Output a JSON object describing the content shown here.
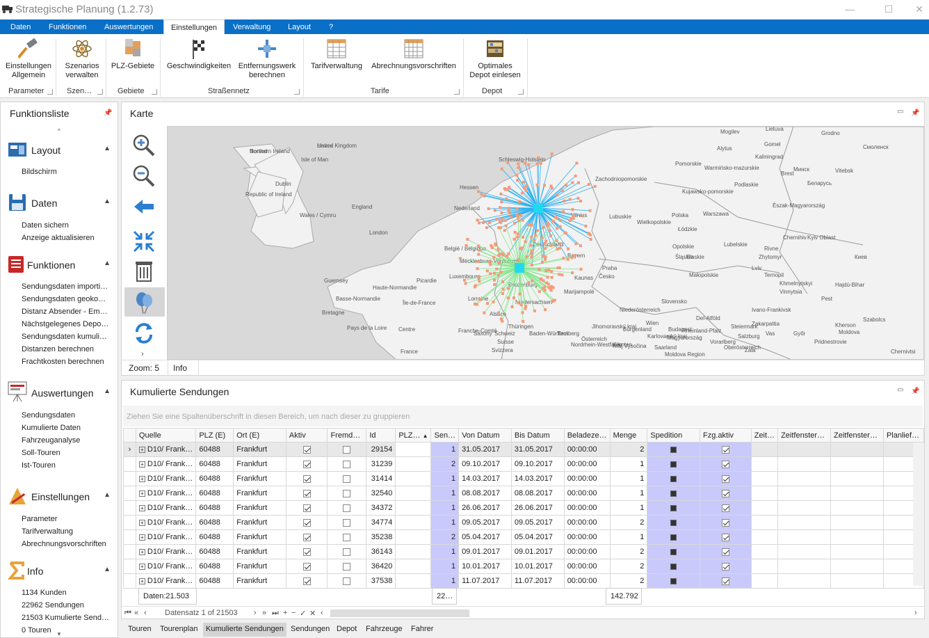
{
  "window": {
    "title": "Strategische Planung (1.2.73)",
    "minimize": "—",
    "maximize": "☐",
    "close": "✕"
  },
  "menubar": {
    "items": [
      "Daten",
      "Funktionen",
      "Auswertungen",
      "Einstellungen",
      "Verwaltung",
      "Layout",
      "?"
    ],
    "active": "Einstellungen"
  },
  "ribbon": {
    "buttons": [
      {
        "label1": "Einstellungen",
        "label2": "Allgemein"
      },
      {
        "label1": "Szenarios",
        "label2": "verwalten"
      },
      {
        "label1": "PLZ-Gebiete",
        "label2": ""
      },
      {
        "label1": "Geschwindigkeiten",
        "label2": ""
      },
      {
        "label1": "Entfernungswerk",
        "label2": "berechnen"
      },
      {
        "label1": "Tarifverwaltung",
        "label2": ""
      },
      {
        "label1": "Abrechnungsvorschriften",
        "label2": ""
      },
      {
        "label1": "Optimales",
        "label2": "Depot einlesen"
      }
    ],
    "groups": [
      "Parameter",
      "Szen…",
      "Gebiete",
      "Straßennetz",
      "Tarife",
      "Depot"
    ]
  },
  "funktionsliste": {
    "title": "Funktionsliste",
    "sections": [
      {
        "label": "Layout",
        "items": [
          "Bildschirm"
        ]
      },
      {
        "label": "Daten",
        "items": [
          "Daten sichern",
          "Anzeige aktualisieren"
        ]
      },
      {
        "label": "Funktionen",
        "items": [
          "Sendungsdaten importi…",
          "Sendungsdaten geoko…",
          "Distanz Absender - Em…",
          "Nächstgelegenes Depo…",
          "Sendungsdaten kumuli…",
          "Distanzen berechnen",
          "Frachtkosten berechnen"
        ]
      },
      {
        "label": "Auswertungen",
        "items": [
          "Sendungsdaten",
          "Kumulierte Daten",
          "Fahrzeuganalyse",
          "Soll-Touren",
          "Ist-Touren"
        ]
      },
      {
        "label": "Einstellungen",
        "items": [
          "Parameter",
          "Tarifverwaltung",
          "Abrechnungsvorschriften"
        ]
      },
      {
        "label": "Info",
        "items": [
          "1134 Kunden",
          "22962 Sendungen",
          "21503 Kumulierte Send…",
          "0 Touren"
        ]
      }
    ]
  },
  "map": {
    "title": "Karte",
    "zoom": "Zoom: 5",
    "info": "Info",
    "labels": [
      "Northern Ireland",
      "United Kingdom",
      "Isle of Man",
      "Dublin",
      "Republic of Ireland",
      "England",
      "Wales / Cymru",
      "London",
      "Nederland",
      "België / Belgique",
      "Luxembourg",
      "Deutschland",
      "Guernsey",
      "Haute-Normandie",
      "Basse-Normandie",
      "Picardie",
      "Île-de-France",
      "Lorraine",
      "Alsace",
      "Bretagne",
      "Pays de la Loire",
      "Centre",
      "Franche-Comté",
      "Schweiz",
      "Suisse",
      "Svizzera",
      "France",
      "Polska",
      "Warszawa",
      "Praha",
      "Česko",
      "Slovensko",
      "Österreich",
      "Budapest",
      "Magyarország",
      "Lietuva",
      "Смоленск",
      "Минск",
      "Беларусь",
      "Киев",
      "Moldova",
      "Kärnten",
      "Burgenland",
      "Bayern",
      "Lubuskie",
      "Łódzkie",
      "Opolskie",
      "Śląskie",
      "Małopolskie",
      "Lubelskie",
      "Pomorskie",
      "Podlaskie",
      "Kujawsko-pomorskie",
      "Warmińsko-mazurskie",
      "Wielkopolskie",
      "Zachodniopomorskie",
      "Mecklenburg-Vorpommern",
      "Schleswig-Holstein",
      "Niedersachsen",
      "Niederösterreich",
      "Tirol",
      "Wien",
      "Slaskie",
      "Lviv",
      "Rivne",
      "Zhytomyr",
      "Chernihiv",
      "Kyiv Oblast",
      "Khmelnytskyi",
      "Vinnytsia",
      "Ternopil",
      "Ivano-Frankivsk",
      "Zakarpattia",
      "Chernivtsi",
      "Kherson",
      "Pridnestrovie",
      "Moldova Region",
      "Del-Alföld",
      "Észak-Magyarország",
      "Brest",
      "Grodno",
      "Vitebsk",
      "Mogilev",
      "Gomel",
      "Kaliningrad",
      "Alytus",
      "Vilnius",
      "Kaunas",
      "Marijampolė",
      "Bradenburg",
      "Saxony",
      "Thüringen",
      "Hessen",
      "Rheinland-Pfalz",
      "Saarland",
      "Baden-Württemberg",
      "Nordrhein-Westfalen",
      "Jihomoravský kraj",
      "Kraj Vysočina",
      "Karlovarský kraj",
      "Vorarlberg",
      "Salzburg",
      "Steiermark",
      "Oberösterreich",
      "Zala",
      "Vas",
      "Győr",
      "Pest",
      "Hajdú-Bihar",
      "Szabolcs",
      "Borsod",
      "Heves"
    ]
  },
  "grid": {
    "title": "Kumulierte Sendungen",
    "grouphint": "Ziehen Sie eine Spaltenüberschrift in diesen Bereich, um nach dieser zu gruppieren",
    "columns": [
      "Quelle",
      "PLZ (E)",
      "Ort (E)",
      "Aktiv",
      "Fremd…",
      "Id",
      "PLZ…",
      "Sen…",
      "Von Datum",
      "Bis Datum",
      "Beladeze…",
      "Menge",
      "Spedition",
      "Fzg.aktiv",
      "Zeit…",
      "Zeitfenster…",
      "Zeitfenster…",
      "Planlief…"
    ],
    "rows": [
      {
        "quelle": "D10/ Frank…",
        "plz": "60488",
        "ort": "Frankfurt",
        "aktiv": true,
        "fremd": false,
        "id": "29154",
        "sen": "1",
        "von": "31.05.2017",
        "bis": "31.05.2017",
        "belade": "00:00:00",
        "menge": "2"
      },
      {
        "quelle": "D10/ Frank…",
        "plz": "60488",
        "ort": "Frankfurt",
        "aktiv": true,
        "fremd": false,
        "id": "31239",
        "sen": "2",
        "von": "09.10.2017",
        "bis": "09.10.2017",
        "belade": "00:00:00",
        "menge": "1"
      },
      {
        "quelle": "D10/ Frank…",
        "plz": "60488",
        "ort": "Frankfurt",
        "aktiv": true,
        "fremd": false,
        "id": "31414",
        "sen": "1",
        "von": "14.03.2017",
        "bis": "14.03.2017",
        "belade": "00:00:00",
        "menge": "1"
      },
      {
        "quelle": "D10/ Frank…",
        "plz": "60488",
        "ort": "Frankfurt",
        "aktiv": true,
        "fremd": false,
        "id": "32540",
        "sen": "1",
        "von": "08.08.2017",
        "bis": "08.08.2017",
        "belade": "00:00:00",
        "menge": "1"
      },
      {
        "quelle": "D10/ Frank…",
        "plz": "60488",
        "ort": "Frankfurt",
        "aktiv": true,
        "fremd": false,
        "id": "34372",
        "sen": "1",
        "von": "26.06.2017",
        "bis": "26.06.2017",
        "belade": "00:00:00",
        "menge": "1"
      },
      {
        "quelle": "D10/ Frank…",
        "plz": "60488",
        "ort": "Frankfurt",
        "aktiv": true,
        "fremd": false,
        "id": "34774",
        "sen": "1",
        "von": "09.05.2017",
        "bis": "09.05.2017",
        "belade": "00:00:00",
        "menge": "2"
      },
      {
        "quelle": "D10/ Frank…",
        "plz": "60488",
        "ort": "Frankfurt",
        "aktiv": true,
        "fremd": false,
        "id": "35238",
        "sen": "2",
        "von": "05.04.2017",
        "bis": "05.04.2017",
        "belade": "00:00:00",
        "menge": "1"
      },
      {
        "quelle": "D10/ Frank…",
        "plz": "60488",
        "ort": "Frankfurt",
        "aktiv": true,
        "fremd": false,
        "id": "36143",
        "sen": "1",
        "von": "09.01.2017",
        "bis": "09.01.2017",
        "belade": "00:00:00",
        "menge": "2"
      },
      {
        "quelle": "D10/ Frank…",
        "plz": "60488",
        "ort": "Frankfurt",
        "aktiv": true,
        "fremd": false,
        "id": "36420",
        "sen": "1",
        "von": "10.01.2017",
        "bis": "10.01.2017",
        "belade": "00:00:00",
        "menge": "2"
      },
      {
        "quelle": "D10/ Frank…",
        "plz": "60488",
        "ort": "Frankfurt",
        "aktiv": true,
        "fremd": false,
        "id": "37538",
        "sen": "1",
        "von": "11.07.2017",
        "bis": "11.07.2017",
        "belade": "00:00:00",
        "menge": "2"
      }
    ],
    "footer": {
      "count": "Daten:21.503",
      "sen": "22…",
      "menge": "142.792"
    },
    "navigator": {
      "record": "Datensatz 1 of 21503"
    }
  },
  "bottomtabs": {
    "items": [
      "Touren",
      "Tourenplan",
      "Kumulierte Sendungen",
      "Sendungen",
      "Depot",
      "Fahrzeuge",
      "Fahrer"
    ],
    "active": "Kumulierte Sendungen"
  },
  "colors": {
    "accent": "#0a6fc7",
    "depot1_spokes": "#2ab0f0",
    "depot2_spokes": "#86e68e",
    "customers": "#f59a7a",
    "highlight": "#c9c9fb"
  }
}
